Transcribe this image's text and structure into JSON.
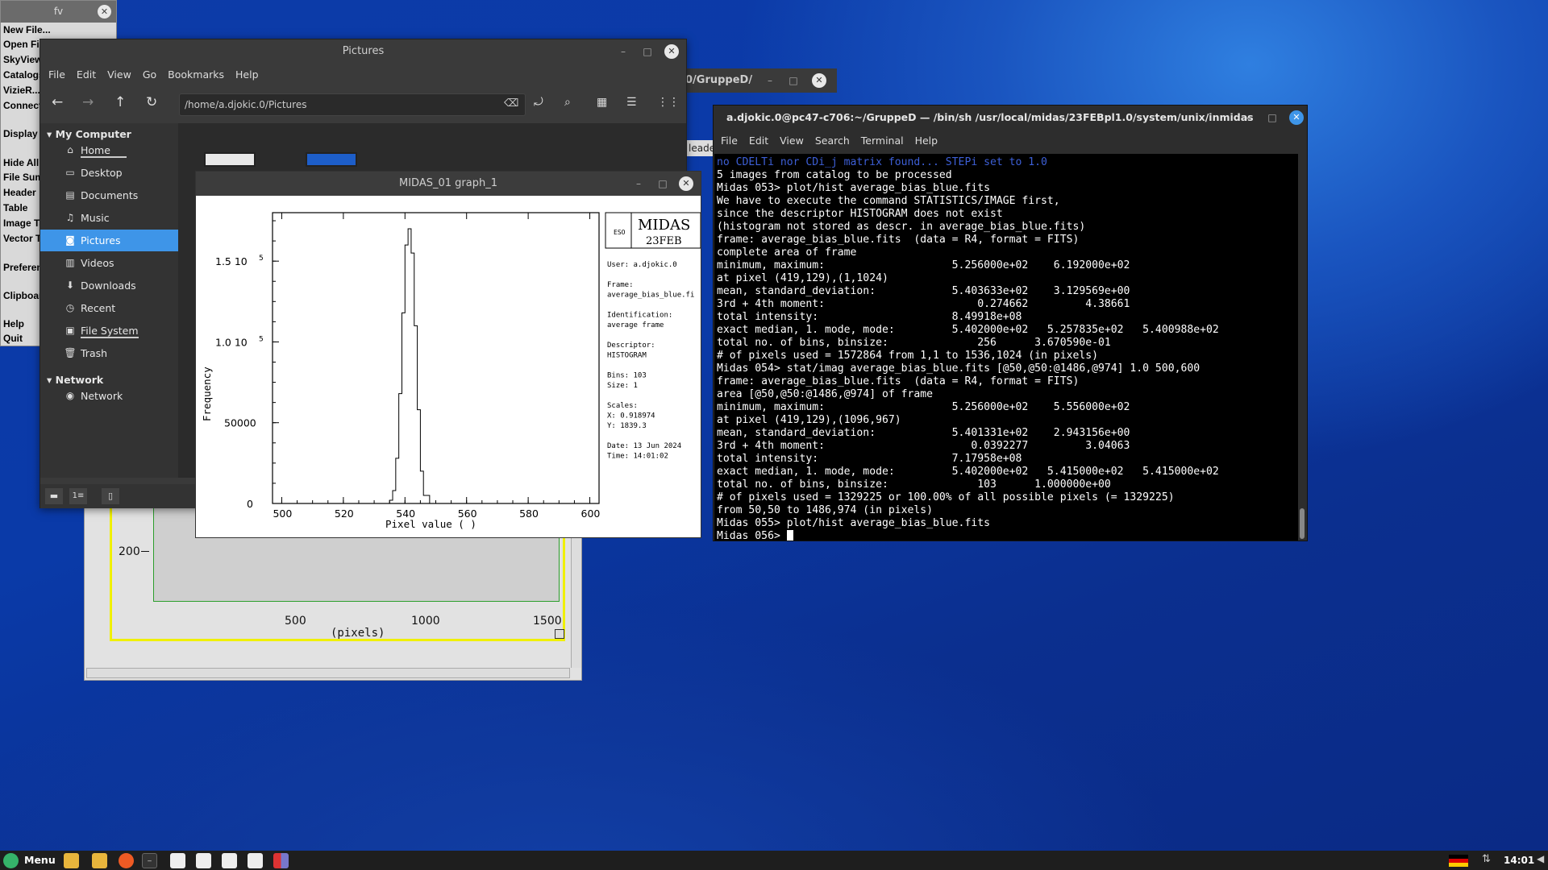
{
  "fv": {
    "title": "fv",
    "items": [
      "New File...",
      "Open File",
      "SkyView",
      "Catalogs",
      "VizieR...",
      "Connect",
      "Display",
      "Hide All",
      "File Summary",
      "Header",
      "Table",
      "Image Table",
      "Vector Table",
      "Preferences",
      "Clipboard",
      "Help",
      "Quit"
    ]
  },
  "imgwin": {
    "ytick": "200",
    "xticks": [
      "500",
      "1000",
      "1500"
    ],
    "xlabel": "(pixels)"
  },
  "back": {
    "title": "0/GruppeD/",
    "leader": "leader"
  },
  "fm": {
    "title": "Pictures",
    "menu": [
      "File",
      "Edit",
      "View",
      "Go",
      "Bookmarks",
      "Help"
    ],
    "path": "/home/a.djokic.0/Pictures",
    "sections": {
      "computer": "My Computer",
      "network": "Network"
    },
    "places": [
      "Home",
      "Desktop",
      "Documents",
      "Music",
      "Pictures",
      "Videos",
      "Downloads",
      "Recent",
      "File System",
      "Trash"
    ],
    "network_items": [
      "Network"
    ],
    "statusbar": "1≡"
  },
  "graph": {
    "title": "MIDAS_01 graph_1",
    "logo_top": "MIDAS",
    "logo_bottom": "23FEB",
    "eso": "ESO",
    "ylabel": "Frequency",
    "xlabel": "Pixel value ( )",
    "yticks": [
      "1.5 10",
      "1.0 10",
      "50000",
      "0"
    ],
    "ytick_exp": "5",
    "info": [
      "User: a.djokic.0",
      "",
      "Frame:",
      "average_bias_blue.fi",
      "",
      "Identification:",
      "average frame",
      "",
      "Descriptor:",
      "HISTOGRAM",
      "",
      "Bins: 103",
      "Size: 1",
      "",
      "Scales:",
      "X:  0.918974",
      "Y:   1839.3",
      "",
      "Date: 13 Jun 2024",
      "Time: 14:01:02"
    ],
    "chart_data": {
      "type": "line",
      "x": [
        529,
        533,
        535,
        536,
        537,
        538,
        539,
        540,
        541,
        542,
        543,
        544,
        545,
        546,
        548,
        552
      ],
      "y": [
        0,
        0,
        2000,
        8000,
        28000,
        68000,
        118000,
        160000,
        170000,
        155000,
        110000,
        58000,
        20000,
        5000,
        0,
        0
      ],
      "xlim": [
        497,
        603
      ],
      "ylim": [
        0,
        180000
      ],
      "xticks": [
        "500",
        "520",
        "540",
        "560",
        "580",
        "600"
      ],
      "xlabel": "Pixel value ( )",
      "ylabel": "Frequency"
    }
  },
  "term": {
    "title": "a.djokic.0@pc47-c706:~/GruppeD — /bin/sh /usr/local/midas/23FEBpl1.0/system/unix/inmidas",
    "menu": [
      "File",
      "Edit",
      "View",
      "Search",
      "Terminal",
      "Help"
    ],
    "lines": [
      "no CDELTi nor CDi_j matrix found... STEPi set to 1.0",
      "5 images from catalog to be processed",
      "Midas 053> plot/hist average_bias_blue.fits",
      "We have to execute the command STATISTICS/IMAGE first,",
      "since the descriptor HISTOGRAM does not exist",
      "(histogram not stored as descr. in average_bias_blue.fits)",
      "frame: average_bias_blue.fits  (data = R4, format = FITS)",
      "complete area of frame",
      "minimum, maximum:                    5.256000e+02    6.192000e+02",
      "at pixel (419,129),(1,1024)",
      "mean, standard_deviation:            5.403633e+02    3.129569e+00",
      "3rd + 4th moment:                        0.274662         4.38661",
      "total intensity:                     8.49918e+08",
      "exact median, 1. mode, mode:         5.402000e+02   5.257835e+02   5.400988e+02",
      "total no. of bins, binsize:              256      3.670590e-01",
      "# of pixels used = 1572864 from 1,1 to 1536,1024 (in pixels)",
      "Midas 054> stat/imag average_bias_blue.fits [@50,@50:@1486,@974] 1.0 500,600",
      "frame: average_bias_blue.fits  (data = R4, format = FITS)",
      "area [@50,@50:@1486,@974] of frame",
      "minimum, maximum:                    5.256000e+02    5.556000e+02",
      "at pixel (419,129),(1096,967)",
      "mean, standard_deviation:            5.401331e+02    2.943156e+00",
      "3rd + 4th moment:                       0.0392277         3.04063",
      "total intensity:                     7.17958e+08",
      "exact median, 1. mode, mode:         5.402000e+02   5.415000e+02   5.415000e+02",
      "total no. of bins, binsize:              103      1.000000e+00",
      "# of pixels used = 1329225 or 100.00% of all possible pixels (= 1329225)",
      "from 50,50 to 1486,974 (in pixels)",
      "Midas 055> plot/hist average_bias_blue.fits",
      "Midas 056> "
    ]
  },
  "taskbar": {
    "menu": "Menu",
    "time": "14:01"
  },
  "colors": {
    "selection": "#3e95e8",
    "window_bg": "#3a3a3a"
  }
}
